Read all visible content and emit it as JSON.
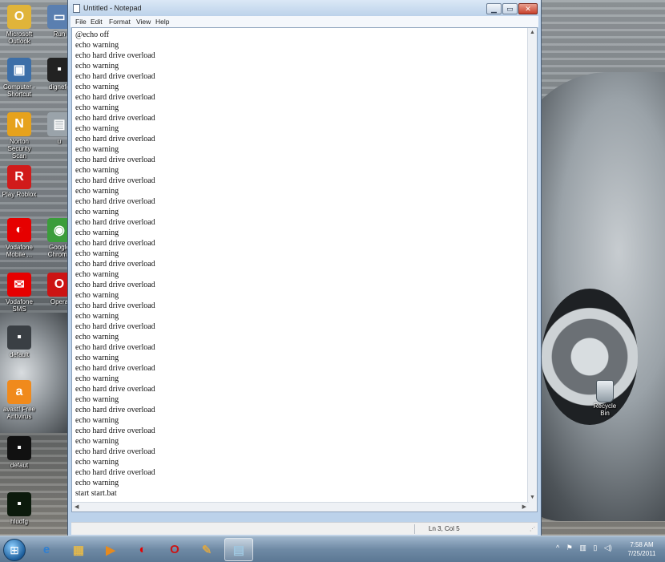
{
  "desktop": {
    "icons": [
      {
        "label": "Microsoft Outlook",
        "icon": "outlook-icon",
        "color": "#e0b43a",
        "glyph": "O"
      },
      {
        "label": "Run",
        "icon": "run-icon",
        "color": "#5a7fb0",
        "glyph": "▭"
      },
      {
        "label": "Computer - Shortcut",
        "icon": "computer-icon",
        "color": "#3d6fa8",
        "glyph": "▣"
      },
      {
        "label": "dignefg",
        "icon": "dignefg-icon",
        "color": "#222222",
        "glyph": "▪"
      },
      {
        "label": "Norton Security Scan",
        "icon": "norton-icon",
        "color": "#e6a21c",
        "glyph": "N"
      },
      {
        "label": "u",
        "icon": "u-icon",
        "color": "#9aa3aa",
        "glyph": "▤"
      },
      {
        "label": "Play Roblox",
        "icon": "roblox-icon",
        "color": "#d11b1b",
        "glyph": "R"
      },
      {
        "label": "Vodafone Mobile ...",
        "icon": "vodafone-icon",
        "color": "#e60000",
        "glyph": "◐"
      },
      {
        "label": "Google Chrome",
        "icon": "chrome-icon",
        "color": "#3b9d3b",
        "glyph": "◉"
      },
      {
        "label": "Vodafone SMS",
        "icon": "vodafone-sms-icon",
        "color": "#e60000",
        "glyph": "✉"
      },
      {
        "label": "Opera",
        "icon": "opera-icon",
        "color": "#cc1414",
        "glyph": "O"
      },
      {
        "label": "default",
        "icon": "default-icon",
        "color": "#3a3f44",
        "glyph": "▪"
      },
      {
        "label": "avast! Free Antivirus",
        "icon": "avast-icon",
        "color": "#f08a1c",
        "glyph": "a"
      },
      {
        "label": "defaut",
        "icon": "defaut-icon",
        "color": "#111111",
        "glyph": "▪"
      },
      {
        "label": "hludfg",
        "icon": "hludfg-icon",
        "color": "#0c1a0c",
        "glyph": "▪"
      }
    ],
    "recycle_bin": {
      "label": "Recycle Bin",
      "icon": "recycle-bin-icon"
    }
  },
  "notepad": {
    "title": "Untitled - Notepad",
    "buttons": {
      "minimize": "▁",
      "maximize": "▭",
      "close": "✕"
    },
    "menu": [
      "File",
      "Edit",
      "Format",
      "View",
      "Help"
    ],
    "lines": [
      "@echo off",
      "echo warning",
      "echo hard drive overload",
      "echo warning",
      "echo hard drive overload",
      "echo warning",
      "echo hard drive overload",
      "echo warning",
      "echo hard drive overload",
      "echo warning",
      "echo hard drive overload",
      "echo warning",
      "echo hard drive overload",
      "echo warning",
      "echo hard drive overload",
      "echo warning",
      "echo hard drive overload",
      "echo warning",
      "echo hard drive overload",
      "echo warning",
      "echo hard drive overload",
      "echo warning",
      "echo hard drive overload",
      "echo warning",
      "echo hard drive overload",
      "echo warning",
      "echo hard drive overload",
      "echo warning",
      "echo hard drive overload",
      "echo warning",
      "echo hard drive overload",
      "echo warning",
      "echo hard drive overload",
      "echo warning",
      "echo hard drive overload",
      "echo warning",
      "echo hard drive overload",
      "echo warning",
      "echo hard drive overload",
      "echo warning",
      "echo hard drive overload",
      "echo warning",
      "echo hard drive overload",
      "echo warning",
      "start start.bat"
    ],
    "status": "Ln 3, Col 5"
  },
  "taskbar": {
    "start_glyph": "⊞",
    "items": [
      {
        "name": "internet-explorer",
        "glyph": "e",
        "color": "#2f7fd1",
        "active": false
      },
      {
        "name": "file-explorer",
        "glyph": "▦",
        "color": "#e2b84c",
        "active": false
      },
      {
        "name": "media-player",
        "glyph": "▶",
        "color": "#e68a1e",
        "active": false
      },
      {
        "name": "vodafone",
        "glyph": "◐",
        "color": "#e60000",
        "active": false
      },
      {
        "name": "opera",
        "glyph": "O",
        "color": "#cc1414",
        "active": false
      },
      {
        "name": "paint",
        "glyph": "✎",
        "color": "#d7a64a",
        "active": false
      },
      {
        "name": "notepad",
        "glyph": "▤",
        "color": "#9fc7e0",
        "active": true
      }
    ],
    "tray": {
      "chevron": "^"
    },
    "clock": {
      "time": "7:58 AM",
      "date": "7/25/2011"
    }
  }
}
